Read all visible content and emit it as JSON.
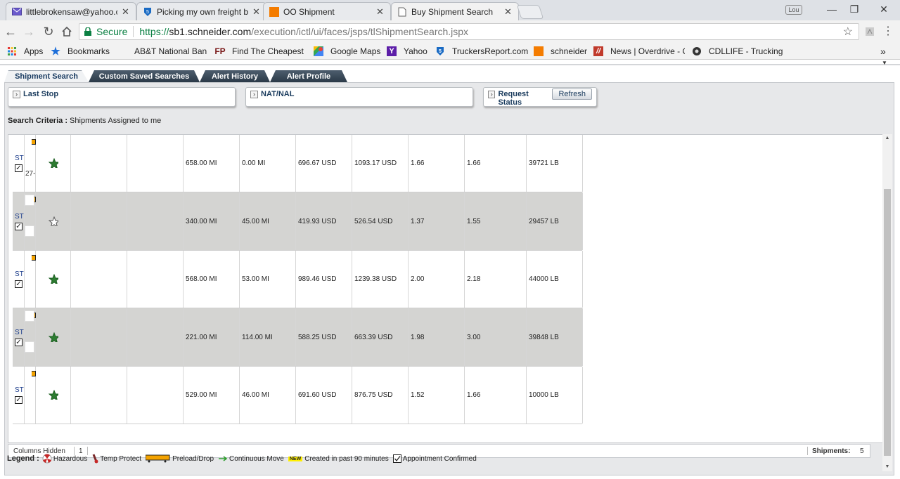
{
  "browser": {
    "tabs": [
      {
        "title": "littlebrokensaw@yahoo.c",
        "icon": "mail-icon"
      },
      {
        "title": "Picking my own freight b",
        "icon": "truckersreport-icon"
      },
      {
        "title": "OO Shipment",
        "icon": "schneider-icon"
      },
      {
        "title": "Buy Shipment Search",
        "icon": "page-icon"
      }
    ],
    "profile_badge": "Lou",
    "window_controls": {
      "minimize": "—",
      "restore": "❐",
      "close": "✕"
    },
    "omnibox": {
      "secure_label": "Secure",
      "url_scheme": "https://",
      "url_host": "sb1.schneider.com",
      "url_path": "/execution/ictl/ui/faces/jsps/tlShipmentSearch.jspx"
    },
    "bookmarks": [
      {
        "label": "Apps",
        "icon": "apps-grid-icon"
      },
      {
        "label": "Bookmarks",
        "icon": "star-icon"
      },
      {
        "label": "AB&T National Bank",
        "icon": ""
      },
      {
        "label": "Find The Cheapest T",
        "icon": "fp-icon"
      },
      {
        "label": "Google Maps",
        "icon": "google-maps-icon"
      },
      {
        "label": "Yahoo",
        "icon": "yahoo-icon"
      },
      {
        "label": "TruckersReport.com",
        "icon": "truckersreport-icon"
      },
      {
        "label": "schneider",
        "icon": "schneider-icon"
      },
      {
        "label": "News | Overdrive - C",
        "icon": "overdrive-icon"
      },
      {
        "label": "CDLLIFE - Trucking N",
        "icon": "cdllife-icon"
      }
    ],
    "more_bookmarks": "»"
  },
  "app": {
    "tabs": [
      {
        "label": "Shipment Search",
        "active": true
      },
      {
        "label": "Custom Saved Searches",
        "active": false
      },
      {
        "label": "Alert History",
        "active": false
      },
      {
        "label": "Alert Profile",
        "active": false
      }
    ],
    "filters": {
      "last_stop": "Last Stop",
      "nat_nal": "NAT/NAL",
      "request_status": "Request Status",
      "refresh": "Refresh"
    },
    "criteria": {
      "label": "Search Criteria :",
      "value": "Shipments Assigned to me"
    },
    "rows": [
      {
        "st": "ST",
        "extra": "27-",
        "starred": true,
        "c1": "658.00 MI",
        "c2": "0.00 MI",
        "c3": "696.67 USD",
        "c4": "1093.17 USD",
        "c5": "1.66",
        "c6": "1.66",
        "c7": "39721 LB"
      },
      {
        "st": "ST",
        "extra": "",
        "starred": false,
        "c1": "340.00 MI",
        "c2": "45.00 MI",
        "c3": "419.93 USD",
        "c4": "526.54 USD",
        "c5": "1.37",
        "c6": "1.55",
        "c7": "29457 LB"
      },
      {
        "st": "ST",
        "extra": "",
        "starred": true,
        "c1": "568.00 MI",
        "c2": "53.00 MI",
        "c3": "989.46 USD",
        "c4": "1239.38 USD",
        "c5": "2.00",
        "c6": "2.18",
        "c7": "44000 LB"
      },
      {
        "st": "ST",
        "extra": "",
        "starred": true,
        "c1": "221.00 MI",
        "c2": "114.00 MI",
        "c3": "588.25 USD",
        "c4": "663.39 USD",
        "c5": "1.98",
        "c6": "3.00",
        "c7": "39848 LB"
      },
      {
        "st": "ST",
        "extra": "",
        "starred": true,
        "c1": "529.00 MI",
        "c2": "46.00 MI",
        "c3": "691.60 USD",
        "c4": "876.75 USD",
        "c5": "1.52",
        "c6": "1.66",
        "c7": "10000 LB"
      }
    ],
    "status": {
      "columns_hidden_label": "Columns Hidden",
      "columns_hidden_value": "1",
      "shipments_label": "Shipments:",
      "shipments_value": "5"
    },
    "legend": {
      "title": "Legend :",
      "items": [
        {
          "label": "Hazardous",
          "icon": "hazardous-icon"
        },
        {
          "label": "Temp Protect",
          "icon": "thermometer-icon"
        },
        {
          "label": "Preload/Drop",
          "icon": "trailer-icon"
        },
        {
          "label": "Continuous Move",
          "icon": "green-arrow-icon"
        },
        {
          "label": "Created in past 90 minutes",
          "icon": "new-badge-icon",
          "badge": "NEW"
        },
        {
          "label": "Appointment Confirmed",
          "icon": "checkbox-icon"
        }
      ]
    },
    "colors": {
      "tab_dark": "#2b3a48",
      "accent_green": "#0b8043",
      "row_alt": "#d4d4d2",
      "panel": "#e7e8ea"
    }
  }
}
